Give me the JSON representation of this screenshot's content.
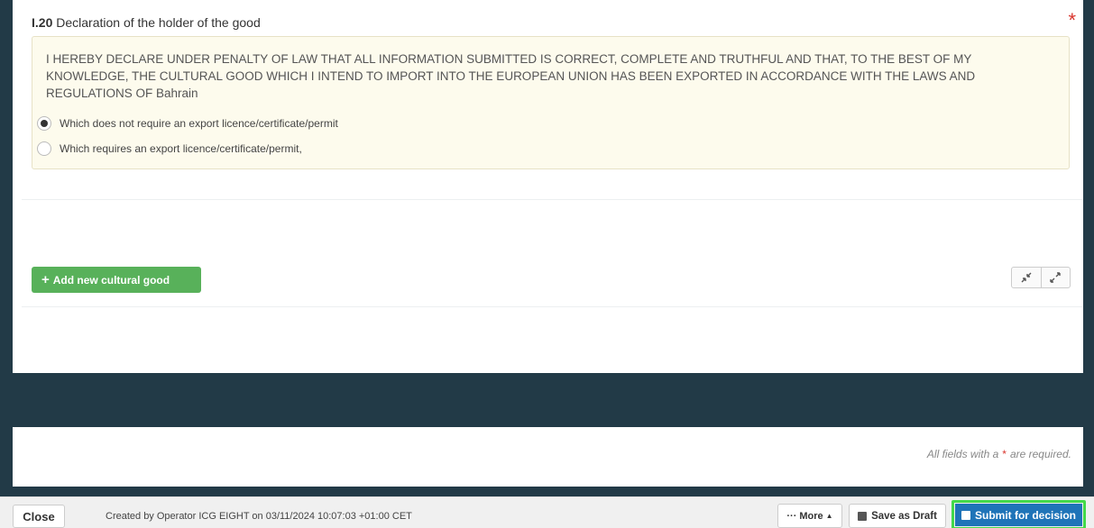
{
  "section": {
    "number": "I.20",
    "title": "Declaration of the holder of the good",
    "required_mark": "*"
  },
  "declaration": {
    "text": "I HEREBY DECLARE UNDER PENALTY OF LAW THAT ALL INFORMATION SUBMITTED IS CORRECT, COMPLETE AND TRUTHFUL AND THAT, TO THE BEST OF MY KNOWLEDGE, THE CULTURAL GOOD WHICH I INTEND TO IMPORT INTO THE EUROPEAN UNION HAS BEEN EXPORTED IN ACCORDANCE WITH THE LAWS AND REGULATIONS OF Bahrain",
    "options": [
      {
        "label": "Which does not require an export licence/certificate/permit",
        "selected": true
      },
      {
        "label": "Which requires an export licence/certificate/permit,",
        "selected": false
      }
    ]
  },
  "actions": {
    "add_good_label": "Add new cultural good",
    "collapse_icon": "collapse-arrows-icon",
    "expand_icon": "expand-arrows-icon"
  },
  "required_note": {
    "prefix": "All fields with a",
    "star": "*",
    "suffix": "are required."
  },
  "footer": {
    "close_label": "Close",
    "created_text": "Created by Operator ICG EIGHT on 03/11/2024 10:07:03 +01:00 CET",
    "more_label": "More",
    "save_draft_label": "Save as Draft",
    "submit_label": "Submit for decision"
  },
  "colors": {
    "accent_green": "#58b15a",
    "primary_blue": "#1f74b8",
    "required_red": "#d9352d",
    "dark_background": "#223a47"
  }
}
